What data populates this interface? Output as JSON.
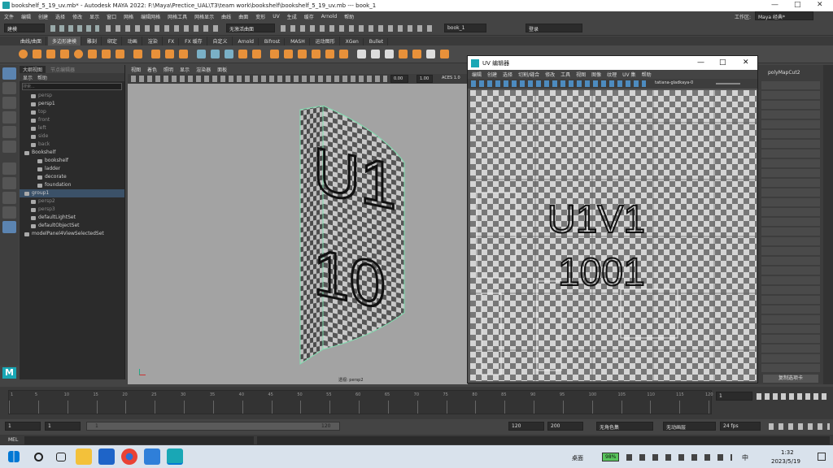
{
  "window": {
    "title": "bookshelf_5_19_uv.mb* - Autodesk MAYA 2022: F:\\Maya\\Prectice_UAL\\T3\\team work\\bookshelf\\bookshelf_5_19_uv.mb  ---  book_1",
    "workspace_label": "工作区:",
    "workspace_value": "Maya 经典*"
  },
  "menubar": [
    "文件",
    "编辑",
    "创建",
    "选择",
    "修改",
    "显示",
    "窗口",
    "网格",
    "编辑网格",
    "网格工具",
    "网格显示",
    "曲线",
    "曲面",
    "变形",
    "UV",
    "生成",
    "缓存",
    "Arnold",
    "帮助"
  ],
  "statusline": {
    "mode": "建模",
    "no_live": "无激活曲面",
    "object_field": "book_1",
    "login": "登录"
  },
  "shelf_tabs": [
    "曲线/曲面",
    "多边形建模",
    "雕刻",
    "绑定",
    "动画",
    "渲染",
    "FX",
    "FX 缓存",
    "自定义",
    "Arnold",
    "Bifrost",
    "MASH",
    "运动图形",
    "XGen",
    "Bullet"
  ],
  "outliner": {
    "tabs": [
      "大纲视图",
      "节点编辑器"
    ],
    "menu": [
      "显示",
      "帮助"
    ],
    "search_placeholder": "搜索...",
    "rows": [
      {
        "label": "persp",
        "dim": true,
        "indent": 1
      },
      {
        "label": "persp1",
        "dim": false,
        "indent": 1
      },
      {
        "label": "top",
        "dim": true,
        "indent": 1
      },
      {
        "label": "front",
        "dim": true,
        "indent": 1
      },
      {
        "label": "left",
        "dim": true,
        "indent": 1
      },
      {
        "label": "side",
        "dim": true,
        "indent": 1
      },
      {
        "label": "back",
        "dim": true,
        "indent": 1
      },
      {
        "label": "Bookshelf",
        "dim": false,
        "indent": 0
      },
      {
        "label": "bookshelf",
        "dim": false,
        "indent": 2
      },
      {
        "label": "ladder",
        "dim": false,
        "indent": 2
      },
      {
        "label": "decorate",
        "dim": false,
        "indent": 2
      },
      {
        "label": "foundation",
        "dim": false,
        "indent": 2
      },
      {
        "label": "group1",
        "dim": false,
        "indent": 0,
        "selected": true
      },
      {
        "label": "persp2",
        "dim": true,
        "indent": 1
      },
      {
        "label": "persp3",
        "dim": true,
        "indent": 1
      },
      {
        "label": "defaultLightSet",
        "dim": false,
        "indent": 1
      },
      {
        "label": "defaultObjectSet",
        "dim": false,
        "indent": 1
      },
      {
        "label": "modelPanel4ViewSelectedSet",
        "dim": false,
        "indent": 0
      }
    ]
  },
  "viewport": {
    "menu": [
      "视图",
      "着色",
      "照明",
      "显示",
      "渲染器",
      "面板"
    ],
    "camera_label": "透视: persp2",
    "field1": "0.00",
    "field2": "1.00",
    "aces": "ACES 1.0",
    "model_text": [
      "U1",
      "10"
    ]
  },
  "uv_editor": {
    "title": "UV 编辑器",
    "menu": [
      "编辑",
      "创建",
      "选择",
      "切割/缝合",
      "修改",
      "工具",
      "视图",
      "图像",
      "纹理",
      "UV 集",
      "帮助"
    ],
    "texture_name": "tatiana-gladkaya-0",
    "udim_text": [
      "U1V1",
      "1001"
    ],
    "right_label": "polyMapCut2",
    "bottom_button": "复制选项卡"
  },
  "timeline": {
    "ticks": [
      "1",
      "5",
      "10",
      "15",
      "20",
      "25",
      "30",
      "35",
      "40",
      "45",
      "50",
      "55",
      "60",
      "65",
      "70",
      "75",
      "80",
      "85",
      "90",
      "95",
      "100",
      "105",
      "110",
      "115",
      "120"
    ],
    "current_frame": "1"
  },
  "range": {
    "start": "1",
    "start2": "1",
    "range_marker": "1",
    "end_marker": "120",
    "end": "120",
    "end2": "200",
    "no_char": "无角色集",
    "no_anim": "无动画层",
    "fps": "24 fps"
  },
  "mel": {
    "label": "MEL"
  },
  "taskbar": {
    "desktop": "桌面",
    "battery": "98%",
    "ime": "中",
    "time": "1:32",
    "date": "2023/5/19"
  }
}
